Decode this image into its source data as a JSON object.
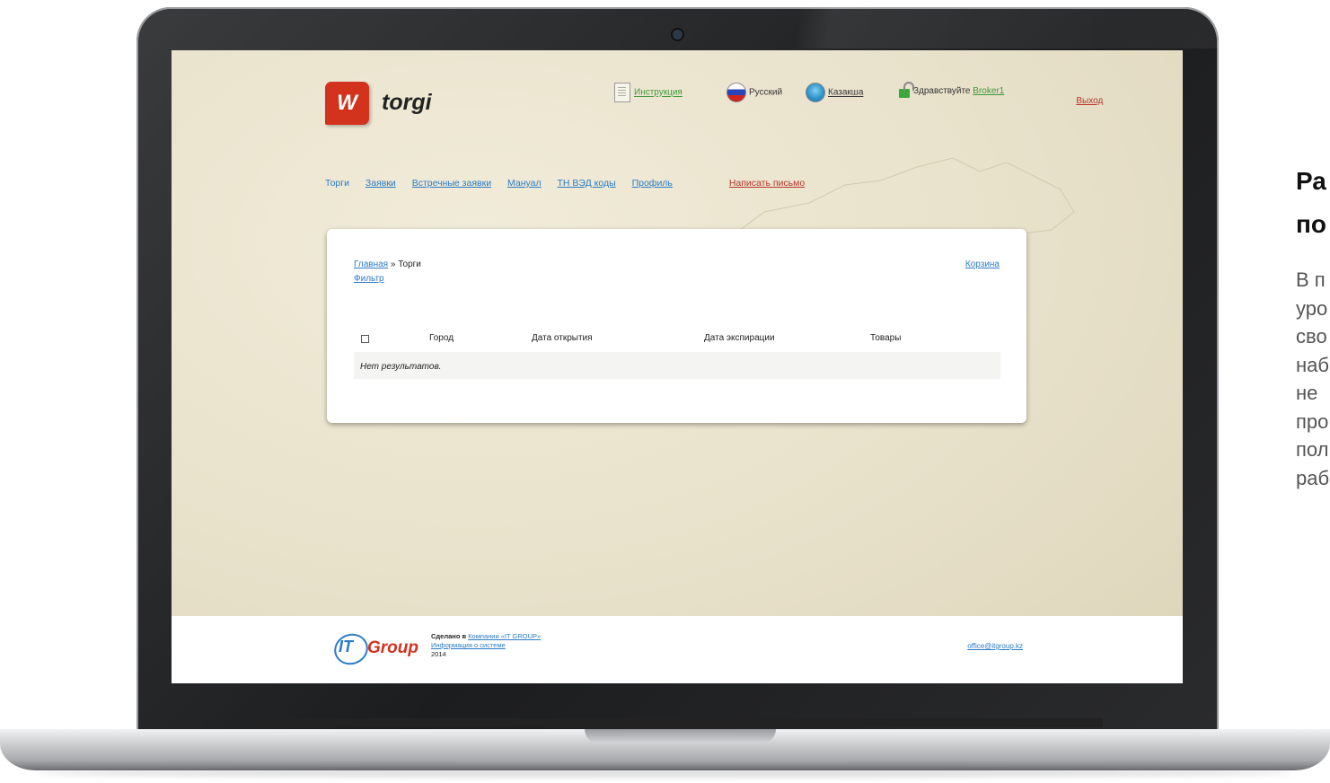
{
  "header": {
    "logo_letter": "W",
    "logo_text": "torgi",
    "instructions_link": "Инструкция",
    "lang_ru": "Русский",
    "lang_kz": "Казакша",
    "greeting": "Здравствуйте",
    "username": "Broker1",
    "logout": "Выход"
  },
  "nav": {
    "items": [
      "Торги",
      "Заявки",
      "Встречные заявки",
      "Мануал",
      "ТН ВЭД коды",
      "Профиль"
    ],
    "write_letter": "Написать письмо"
  },
  "content": {
    "breadcrumb_home": "Главная",
    "breadcrumb_sep": "»",
    "breadcrumb_current": "Торги",
    "filter_link": "Фильтр",
    "cart_link": "Корзина",
    "columns": [
      "Город",
      "Дата открытия",
      "Дата экспирации",
      "Товары"
    ],
    "no_results": "Нет результатов."
  },
  "footer": {
    "logo_it": "IT",
    "logo_group": "Group",
    "made_by_prefix": "Сделано в",
    "made_by_link": "Компании «IT GROUP»",
    "system_info_link": "Информация о системе",
    "year": "2014",
    "email": "office@itgroup.kz"
  },
  "side": {
    "title_line1": "Ра",
    "title_line2": "по",
    "text_lines": [
      "В п",
      "уро",
      "сво",
      "наб",
      "не",
      "про",
      "пол",
      "раб"
    ]
  }
}
